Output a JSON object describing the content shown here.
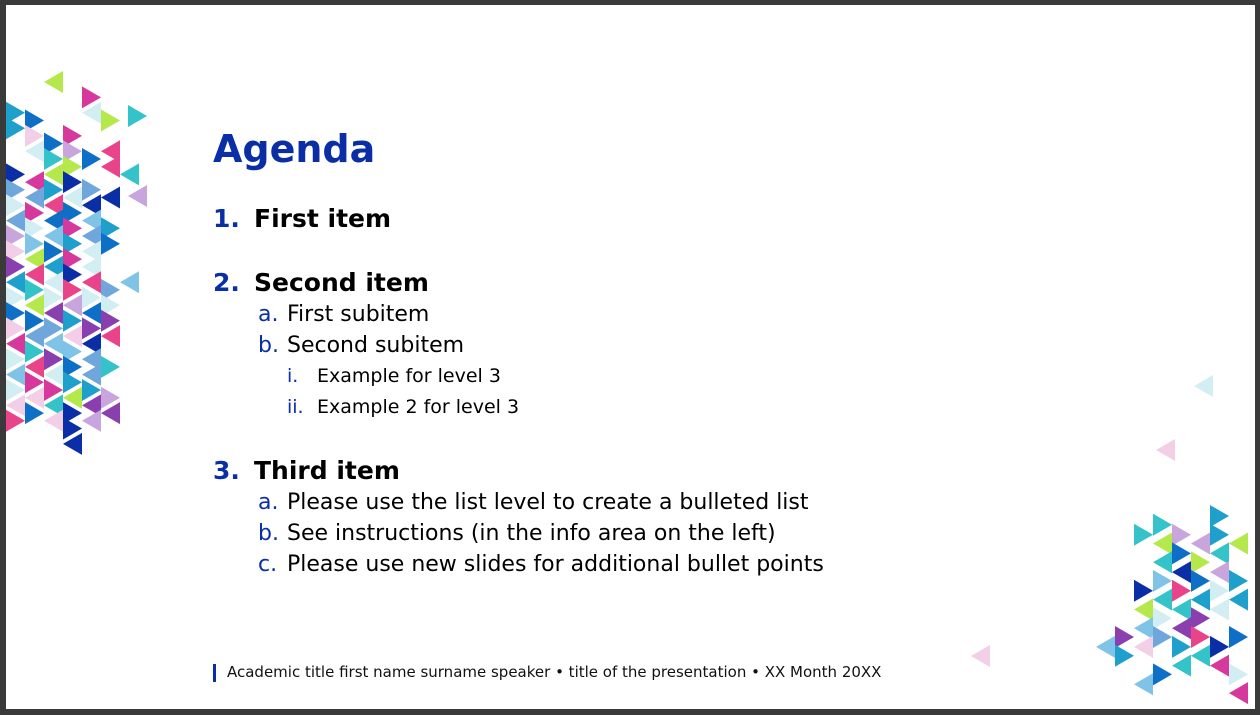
{
  "slide": {
    "title": "Agenda",
    "items": [
      {
        "num": "1.",
        "label": "First item",
        "subitems": []
      },
      {
        "num": "2.",
        "label": "Second item",
        "subitems": [
          {
            "num": "a.",
            "label": "First subitem",
            "subitems": []
          },
          {
            "num": "b.",
            "label": "Second subitem",
            "subitems": [
              {
                "num": "i.",
                "label": "Example for level 3"
              },
              {
                "num": "ii.",
                "label": "Example 2 for level 3"
              }
            ]
          }
        ]
      },
      {
        "num": "3.",
        "label": "Third item",
        "subitems": [
          {
            "num": "a.",
            "label": "Please use the list level to create a bulleted list",
            "subitems": []
          },
          {
            "num": "b.",
            "label": "See instructions (in the info area on the left)",
            "subitems": []
          },
          {
            "num": "c.",
            "label": "Please use new slides for additional bullet points",
            "subitems": []
          }
        ]
      }
    ],
    "footer": "Academic title first name surname speaker • title of the presentation • XX Month 20XX"
  },
  "colors": {
    "accent": "#0a2ea5",
    "text": "#000000",
    "background": "#ffffff",
    "frame": "#3a3a3a",
    "decoration": [
      "#33c3c8",
      "#1f9fcc",
      "#0a2ea5",
      "#0e6fc7",
      "#7fc3e6",
      "#d3eef3",
      "#b5e84a",
      "#d6389c",
      "#e9438a",
      "#8a3fae",
      "#c9a5dd",
      "#f2cfe6",
      "#6fa7dd"
    ]
  },
  "icons": [
    "triangle-pattern-left",
    "triangle-pattern-right"
  ]
}
